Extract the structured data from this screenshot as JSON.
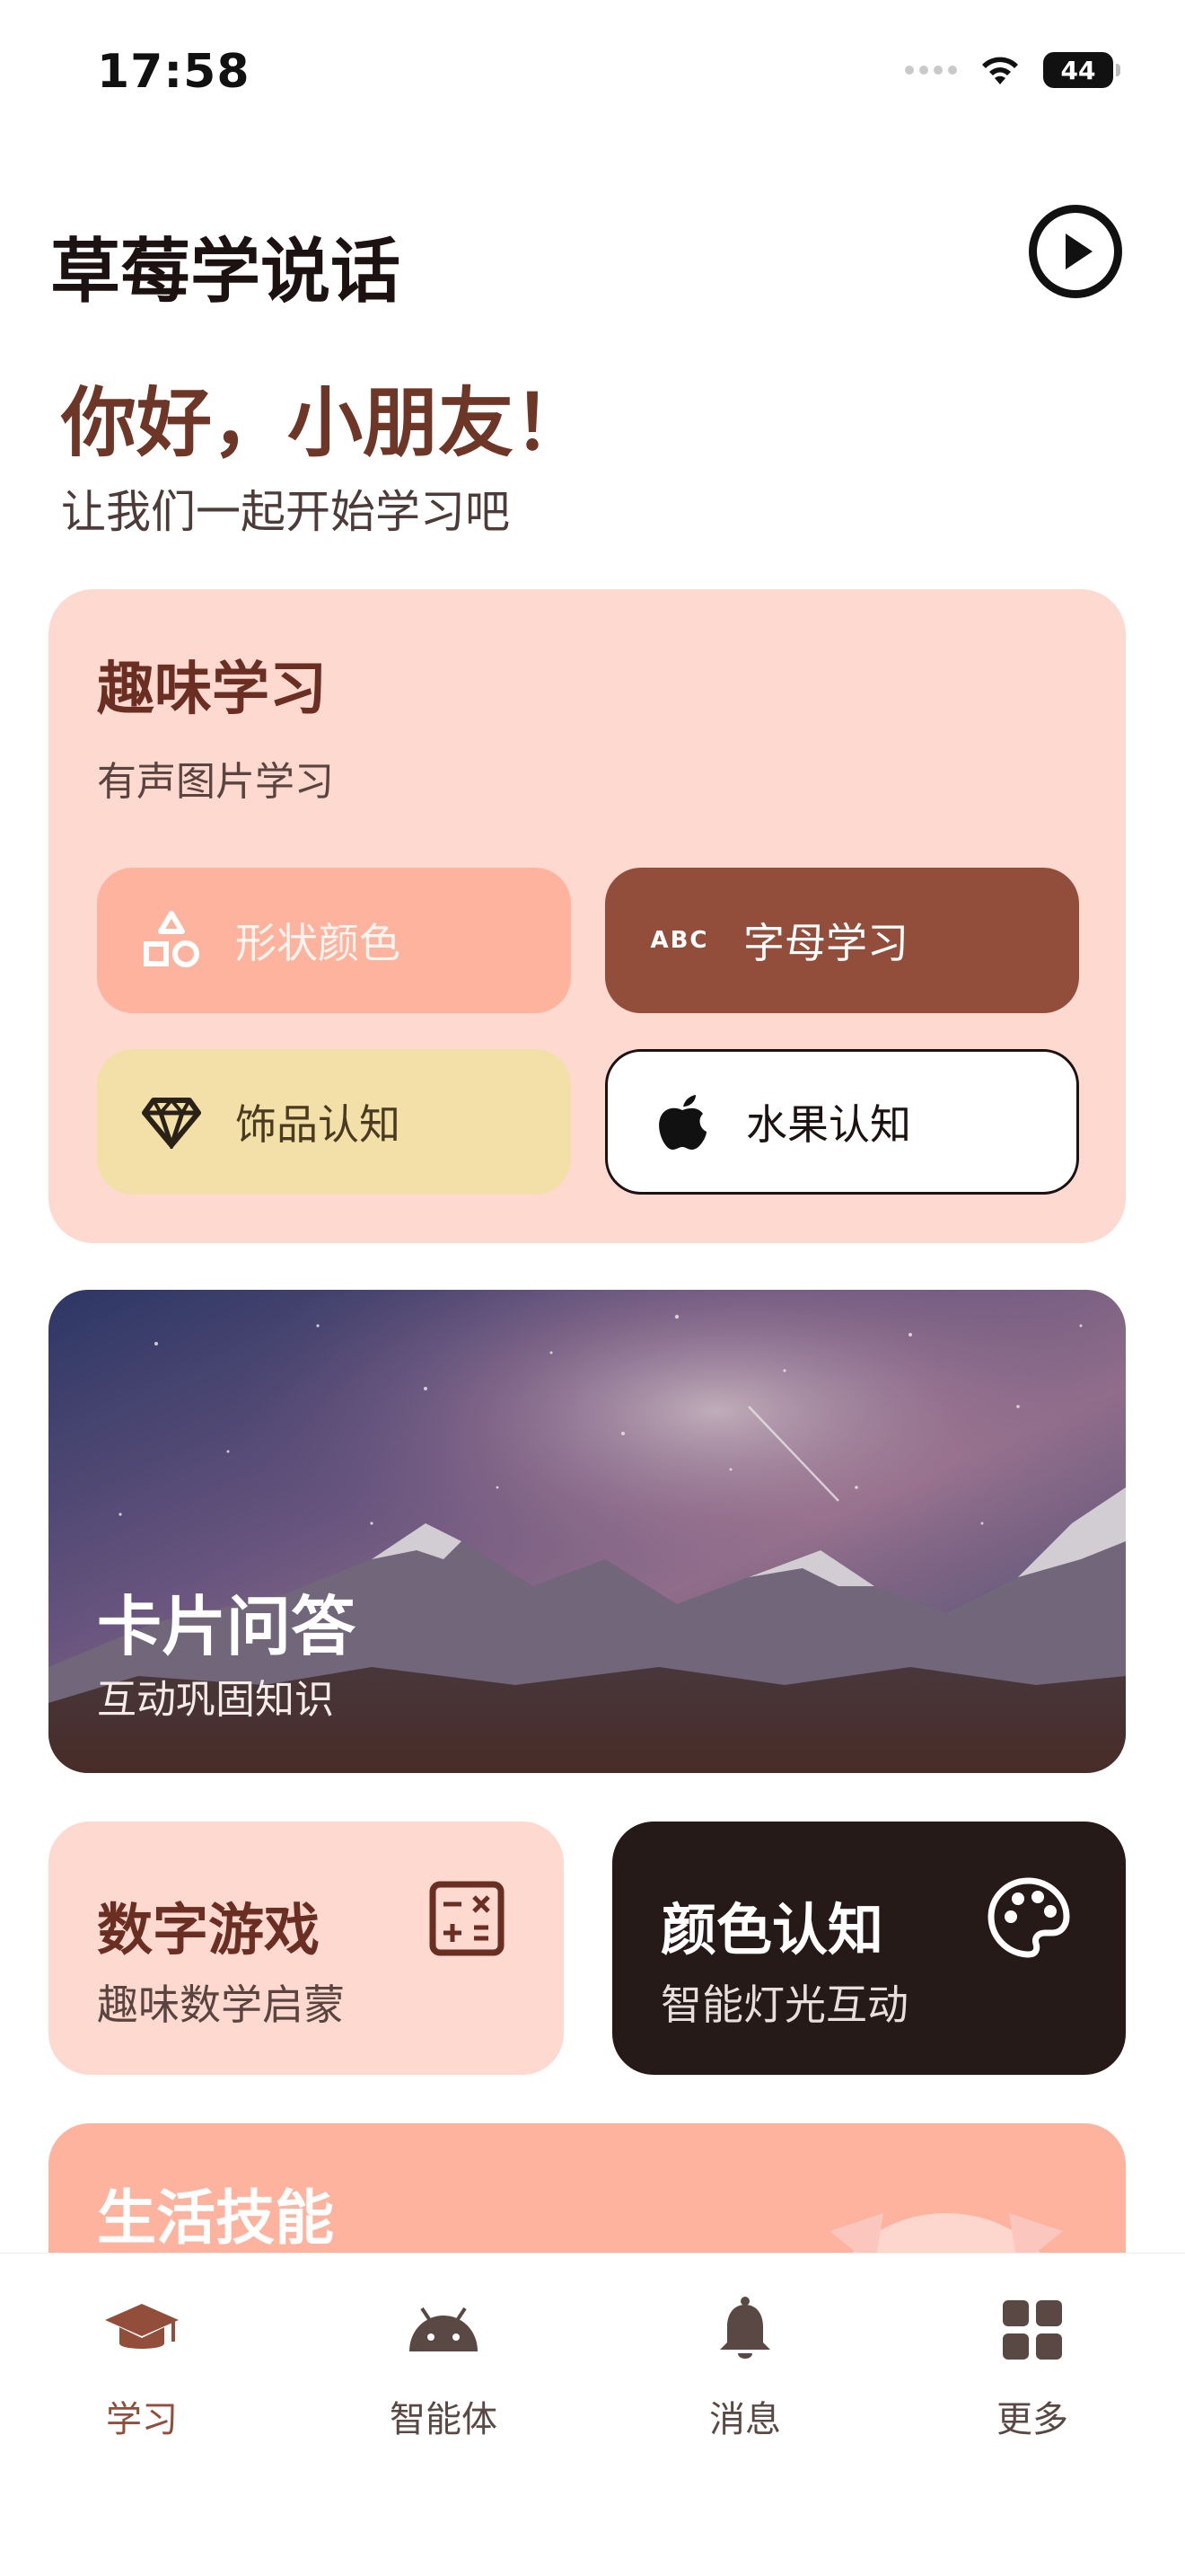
{
  "status_bar": {
    "time": "17:58",
    "battery": "44"
  },
  "header": {
    "title": "草莓学说话"
  },
  "greeting": {
    "title": "你好，小朋友！",
    "subtitle": "让我们一起开始学习吧"
  },
  "fun_learning": {
    "title": "趣味学习",
    "subtitle": "有声图片学习",
    "buttons": [
      {
        "label": "形状颜色",
        "icon": "shapes-icon"
      },
      {
        "label": "字母学习",
        "icon": "abc-icon",
        "icon_text": "ABC"
      },
      {
        "label": "饰品认知",
        "icon": "diamond-icon"
      },
      {
        "label": "水果认知",
        "icon": "apple-icon"
      }
    ]
  },
  "quiz_card": {
    "title": "卡片问答",
    "subtitle": "互动巩固知识"
  },
  "number_game": {
    "title": "数字游戏",
    "subtitle": "趣味数学启蒙",
    "icon": "calculator-icon"
  },
  "color_recognition": {
    "title": "颜色认知",
    "subtitle": "智能灯光互动",
    "icon": "palette-icon"
  },
  "life_skills": {
    "title": "生活技能"
  },
  "bottom_nav": {
    "items": [
      {
        "label": "学习",
        "icon": "graduation-cap-icon",
        "active": true
      },
      {
        "label": "智能体",
        "icon": "android-icon",
        "active": false
      },
      {
        "label": "消息",
        "icon": "bell-icon",
        "active": false
      },
      {
        "label": "更多",
        "icon": "grid-icon",
        "active": false
      }
    ]
  },
  "colors": {
    "accent": "#924e3b",
    "card_pink": "#fdd9cf",
    "salmon": "#fdb39e",
    "dark": "#251a18",
    "yellow": "#f2e0a8"
  }
}
